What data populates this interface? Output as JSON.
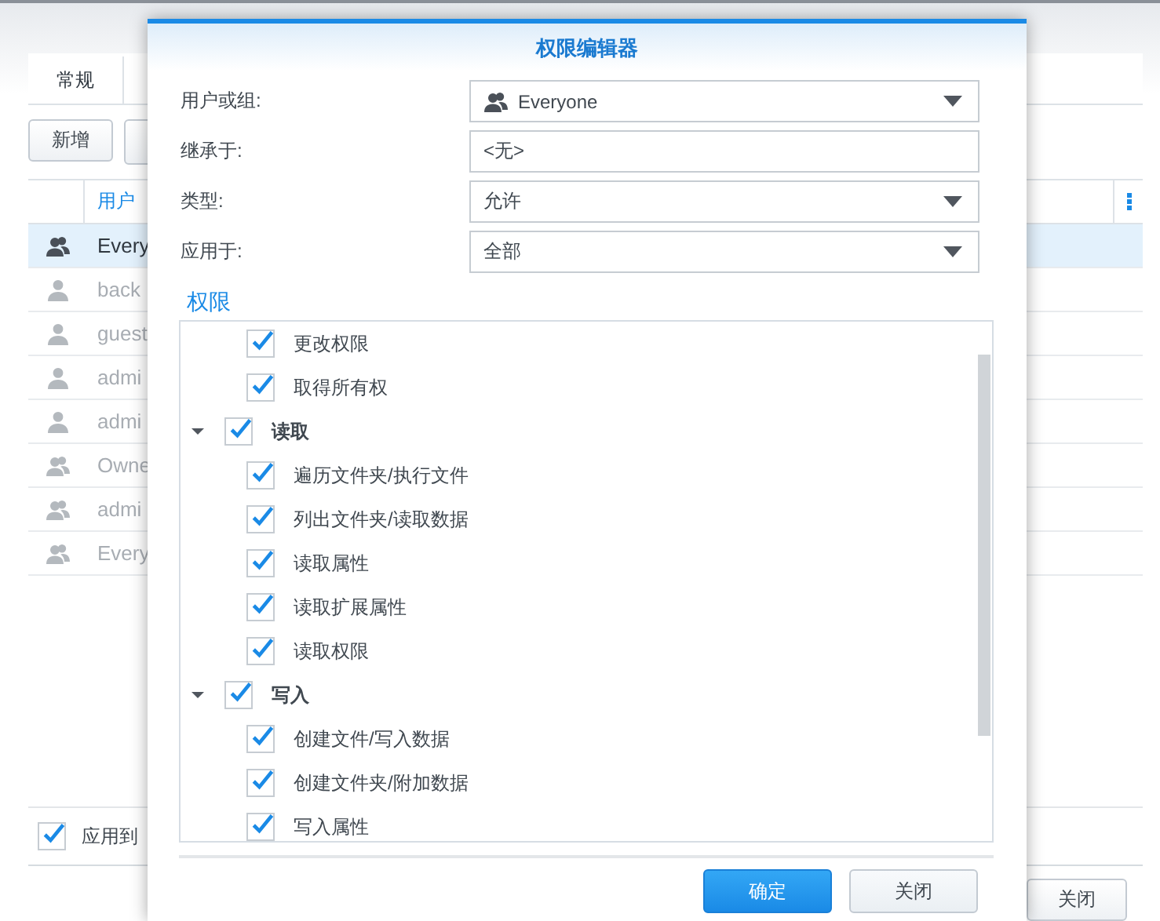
{
  "background": {
    "tabs": [
      {
        "label": "常规",
        "selected": true
      }
    ],
    "toolbar": [
      "新增"
    ],
    "table": {
      "header": "用户",
      "rows": [
        {
          "kind": "group",
          "name": "Every",
          "selected": true,
          "disabled": false
        },
        {
          "kind": "user",
          "name": "back",
          "selected": false,
          "disabled": true
        },
        {
          "kind": "user",
          "name": "guest",
          "selected": false,
          "disabled": true
        },
        {
          "kind": "user",
          "name": "admi",
          "selected": false,
          "disabled": true
        },
        {
          "kind": "user",
          "name": "admi",
          "selected": false,
          "disabled": true
        },
        {
          "kind": "group",
          "name": "Owne",
          "selected": false,
          "disabled": true
        },
        {
          "kind": "group",
          "name": "admi",
          "selected": false,
          "disabled": true
        },
        {
          "kind": "group",
          "name": "Every",
          "selected": false,
          "disabled": true
        }
      ]
    },
    "apply_checkbox": {
      "label": "应用到",
      "checked": true
    },
    "buttons": [
      "关闭"
    ]
  },
  "dialog": {
    "title": "权限编辑器",
    "fields": [
      {
        "label": "用户或组:",
        "kind": "group_dropdown",
        "value": "Everyone"
      },
      {
        "label": "继承于:",
        "kind": "text",
        "value": "<无>"
      },
      {
        "label": "类型:",
        "kind": "dropdown",
        "value": "允许"
      },
      {
        "label": "应用于:",
        "kind": "dropdown",
        "value": "全部"
      }
    ],
    "section_title": "权限",
    "tree_leading_children": [
      {
        "label": "更改权限",
        "checked": true
      },
      {
        "label": "取得所有权",
        "checked": true
      }
    ],
    "tree": [
      {
        "label": "读取",
        "checked": true,
        "expanded": true,
        "children": [
          {
            "label": "遍历文件夹/执行文件",
            "checked": true
          },
          {
            "label": "列出文件夹/读取数据",
            "checked": true
          },
          {
            "label": "读取属性",
            "checked": true
          },
          {
            "label": "读取扩展属性",
            "checked": true
          },
          {
            "label": "读取权限",
            "checked": true
          }
        ]
      },
      {
        "label": "写入",
        "checked": true,
        "expanded": true,
        "children": [
          {
            "label": "创建文件/写入数据",
            "checked": true
          },
          {
            "label": "创建文件夹/附加数据",
            "checked": true
          },
          {
            "label": "写入属性",
            "checked": true
          }
        ]
      }
    ],
    "buttons": [
      {
        "label": "确定",
        "kind": "primary"
      },
      {
        "label": "关闭",
        "kind": "normal"
      }
    ]
  }
}
